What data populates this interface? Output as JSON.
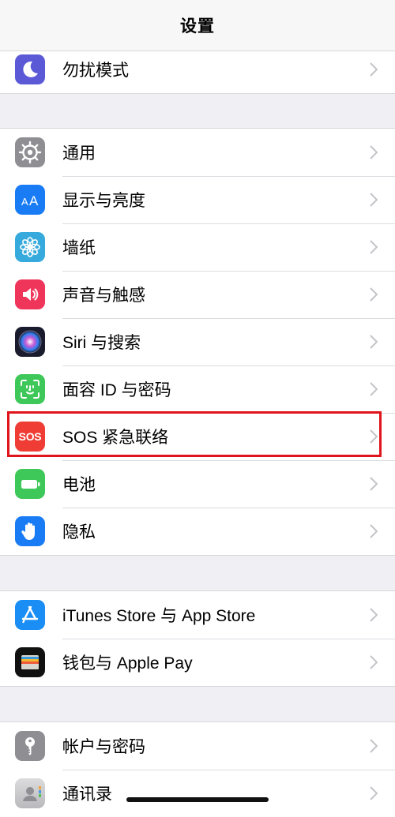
{
  "navbar": {
    "title": "设置"
  },
  "groups": [
    {
      "items": [
        {
          "label": "勿扰模式",
          "icon": "moon-icon",
          "color": "#5b59d6"
        }
      ]
    },
    {
      "items": [
        {
          "label": "通用",
          "icon": "gear-icon",
          "color": "#8e8e93"
        },
        {
          "label": "显示与亮度",
          "icon": "text-size-icon",
          "color": "#1a7cf5"
        },
        {
          "label": "墙纸",
          "icon": "flower-icon",
          "color": "#36aadc"
        },
        {
          "label": "声音与触感",
          "icon": "speaker-icon",
          "color": "#f0355b"
        },
        {
          "label": "Siri 与搜索",
          "icon": "siri-icon",
          "color": "#1b1b2e"
        },
        {
          "label": "面容 ID 与密码",
          "icon": "face-id-icon",
          "color": "#3ec85a"
        },
        {
          "label": "SOS 紧急联络",
          "icon": "sos-icon",
          "color": "#ef3c35",
          "icon_text": "SOS"
        },
        {
          "label": "电池",
          "icon": "battery-icon",
          "color": "#3ec85a"
        },
        {
          "label": "隐私",
          "icon": "hand-icon",
          "color": "#1a7cf5"
        }
      ]
    },
    {
      "items": [
        {
          "label": "iTunes Store 与 App Store",
          "icon": "app-store-icon",
          "color": "#1a8ef5"
        },
        {
          "label": "钱包与 Apple Pay",
          "icon": "wallet-icon",
          "color": "#111111"
        }
      ]
    },
    {
      "items": [
        {
          "label": "帐户与密码",
          "icon": "key-icon",
          "color": "#8e8e93"
        },
        {
          "label": "通讯录",
          "icon": "contacts-icon",
          "color": "#c9c9cc"
        }
      ]
    }
  ],
  "highlight_color": "#e0141c"
}
